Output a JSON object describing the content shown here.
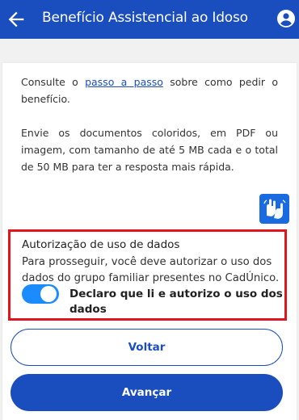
{
  "header": {
    "title": "Benefício Assistencial ao Idoso",
    "back_icon": "arrow-left-icon",
    "account_icon": "user-circle-icon",
    "color": "#1a4ebf"
  },
  "content": {
    "p1_before": "Consulte o ",
    "p1_link": "passo a passo",
    "p1_after": " sobre como pedir o benefício.",
    "p2": "Envie os documentos coloridos, em PDF ou imagem, com tamanho de até 5 MB cada e o total de 50 MB para ter a resposta mais rápida.",
    "libras_icon": "sign-language-hands-icon"
  },
  "authorization": {
    "title": "Autorização de uso de dados",
    "text": "Para prosseguir, você deve autorizar o uso dos dados do grupo familiar presentes no CadÚnico.",
    "toggle_label": "Declaro que li e autorizo o uso dos dados",
    "toggle_on": true,
    "highlight_color": "#e1151c"
  },
  "buttons": {
    "back_label": "Voltar",
    "next_label": "Avançar"
  }
}
